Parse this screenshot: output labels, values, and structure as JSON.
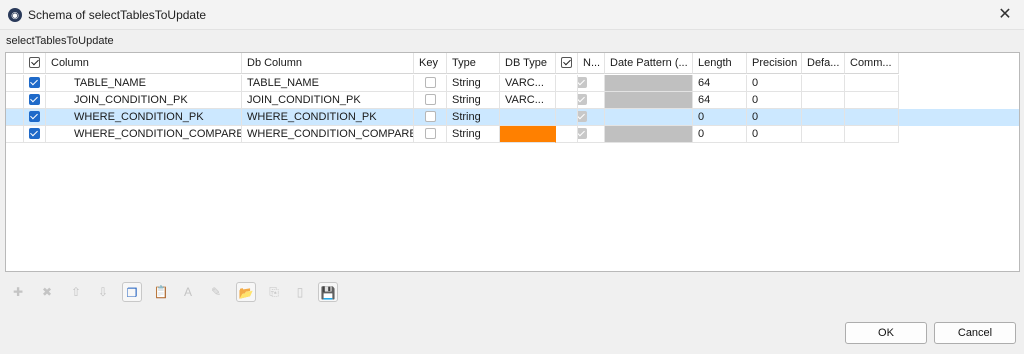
{
  "window": {
    "title": "Schema of selectTablesToUpdate",
    "icon": "app-logo-icon",
    "close_glyph": "✕"
  },
  "schema_label": "selectTablesToUpdate",
  "table": {
    "headers": [
      "",
      "Column",
      "Db Column",
      "Key",
      "Type",
      "DB Type",
      "",
      "N...",
      "Date Pattern (...",
      "Length",
      "Precision",
      "Defa...",
      "Comm..."
    ],
    "rows": [
      {
        "checked": true,
        "column": "TABLE_NAME",
        "db_column": "TABLE_NAME",
        "key": false,
        "type": "String",
        "db_type": "VARC...",
        "nullable": true,
        "length": "64",
        "precision": "0",
        "selected": false
      },
      {
        "checked": true,
        "column": "JOIN_CONDITION_PK",
        "db_column": "JOIN_CONDITION_PK",
        "key": false,
        "type": "String",
        "db_type": "VARC...",
        "nullable": true,
        "length": "64",
        "precision": "0",
        "selected": false
      },
      {
        "checked": true,
        "column": "WHERE_CONDITION_PK",
        "db_column": "WHERE_CONDITION_PK",
        "key": false,
        "type": "String",
        "db_type": "",
        "nullable": true,
        "length": "0",
        "precision": "0",
        "selected": true
      },
      {
        "checked": true,
        "column": "WHERE_CONDITION_COMPARE",
        "db_column": "WHERE_CONDITION_COMPARE",
        "key": false,
        "type": "String",
        "db_type": "",
        "nullable": true,
        "length": "0",
        "precision": "0",
        "selected": false
      }
    ]
  },
  "toolbar": {
    "buttons": [
      {
        "name": "add-icon",
        "glyph": "✚",
        "active": false
      },
      {
        "name": "delete-icon",
        "glyph": "✖",
        "active": false
      },
      {
        "name": "move-up-icon",
        "glyph": "⇧",
        "active": false
      },
      {
        "name": "move-down-icon",
        "glyph": "⇩",
        "active": false
      },
      {
        "name": "copy-icon",
        "glyph": "❐",
        "active": true
      },
      {
        "name": "paste-icon",
        "glyph": "📋",
        "active": false
      },
      {
        "name": "font-icon",
        "glyph": "A",
        "active": false
      },
      {
        "name": "edit-icon",
        "glyph": "✎",
        "active": false
      },
      {
        "name": "import-icon",
        "glyph": "📂",
        "active": true
      },
      {
        "name": "export-icon",
        "glyph": "⎘",
        "active": false
      },
      {
        "name": "reset-icon",
        "glyph": "▯",
        "active": false
      },
      {
        "name": "save-icon",
        "glyph": "💾",
        "active": true
      }
    ]
  },
  "buttons": {
    "ok": "OK",
    "cancel": "Cancel"
  },
  "colors": {
    "selection": "#cce8ff",
    "accent": "#1f6ac9",
    "db_type_missing": "#ff8000",
    "disabled_cell": "#c0c0c0"
  }
}
